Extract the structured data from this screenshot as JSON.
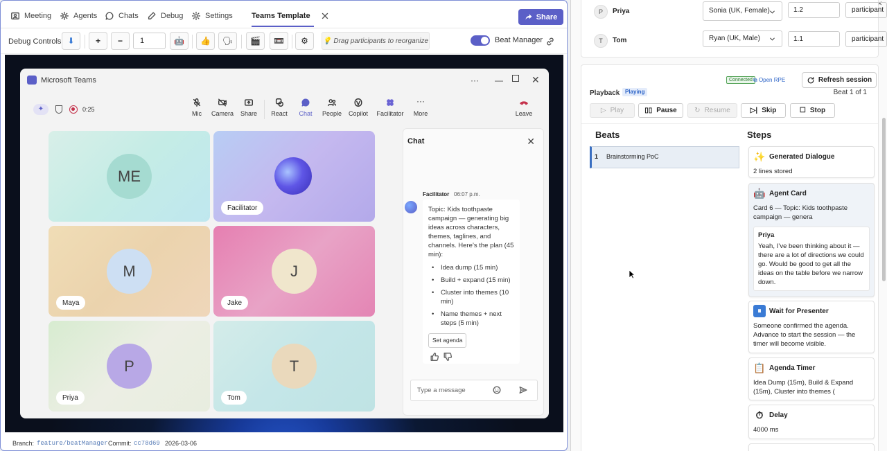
{
  "tabs": [
    {
      "label": "Meeting",
      "icon": "meeting-icon"
    },
    {
      "label": "Agents",
      "icon": "agents-icon"
    },
    {
      "label": "Chats",
      "icon": "chats-icon"
    },
    {
      "label": "Debug",
      "icon": "debug-icon"
    },
    {
      "label": "Settings",
      "icon": "settings-icon"
    },
    {
      "label": "Teams Template",
      "icon": "close-icon"
    }
  ],
  "share_label": "Share",
  "debug": {
    "label": "Debug Controls:",
    "step_value": "1",
    "drag_hint": "Drag participants to reorganize",
    "beat_manager_label": "Beat Manager"
  },
  "teams": {
    "title": "Microsoft Teams",
    "timer": "0:25",
    "tools": [
      "Mic",
      "Camera",
      "Share",
      "React",
      "Chat",
      "People",
      "Copilot",
      "Facilitator",
      "More",
      "Leave"
    ]
  },
  "tiles": [
    {
      "initials": "ME",
      "name": ""
    },
    {
      "initials": "",
      "name": "Facilitator"
    },
    {
      "initials": "M",
      "name": "Maya"
    },
    {
      "initials": "J",
      "name": "Jake"
    },
    {
      "initials": "P",
      "name": "Priya"
    },
    {
      "initials": "T",
      "name": "Tom"
    }
  ],
  "chat": {
    "title": "Chat",
    "sender": "Facilitator",
    "time": "06:07 p.m.",
    "message": "Topic: Kids toothpaste campaign — generating big ideas across characters, themes, taglines, and channels. Here’s the plan (45 min):",
    "bullets": [
      "Idea dump (15 min)",
      "Build + expand (15 min)",
      "Cluster into themes (10 min)",
      "Name themes + next steps (5 min)"
    ],
    "action": "Set agenda",
    "placeholder": "Type a message"
  },
  "footer": {
    "branch_label": "Branch:",
    "branch": "feature/beatManager",
    "commit_label": "Commit:",
    "commit": "cc78d69",
    "date": "2026-03-06"
  },
  "participants": [
    {
      "initial": "P",
      "name": "Priya",
      "voice": "Sonia (UK, Female)",
      "rate": "1.2",
      "role": "participant"
    },
    {
      "initial": "T",
      "name": "Tom",
      "voice": "Ryan (UK, Male)",
      "rate": "1.1",
      "role": "participant"
    }
  ],
  "playback": {
    "connected": "Connected",
    "open_rpe": "Open RPE",
    "refresh": "Refresh session",
    "label": "Playback",
    "status": "Playing",
    "beat_of": "Beat 1 of 1",
    "buttons": [
      "Play",
      "Pause",
      "Resume",
      "Skip",
      "Stop"
    ]
  },
  "beats_heading": "Beats",
  "steps_heading": "Steps",
  "beats": [
    {
      "number": "1",
      "name": "Brainstorming PoC"
    }
  ],
  "steps": [
    {
      "emoji": "✨",
      "title": "Generated Dialogue",
      "body": "2 lines stored"
    },
    {
      "emoji": "🤖",
      "title": "Agent Card",
      "body": "Card 6 — Topic: Kids toothpaste campaign — genera",
      "inner_name": "Priya",
      "inner_text": "Yeah, I’ve been thinking about it — there are a lot of directions we could go. Would be good to get all the ideas on the table before we narrow down."
    },
    {
      "emoji": "⏸",
      "title": "Wait for Presenter",
      "body": "Someone confirmed the agenda. Advance to start the session — the timer will become visible."
    },
    {
      "emoji": "📋",
      "title": "Agenda Timer",
      "body": "Idea Dump (15m), Build & Expand (15m), Cluster into themes ("
    },
    {
      "emoji": "⏱",
      "title": "Delay",
      "body": "4000 ms"
    }
  ],
  "colors": {
    "accent": "#5b5fc7",
    "link": "#2b63c7",
    "leave": "#c4314b"
  }
}
